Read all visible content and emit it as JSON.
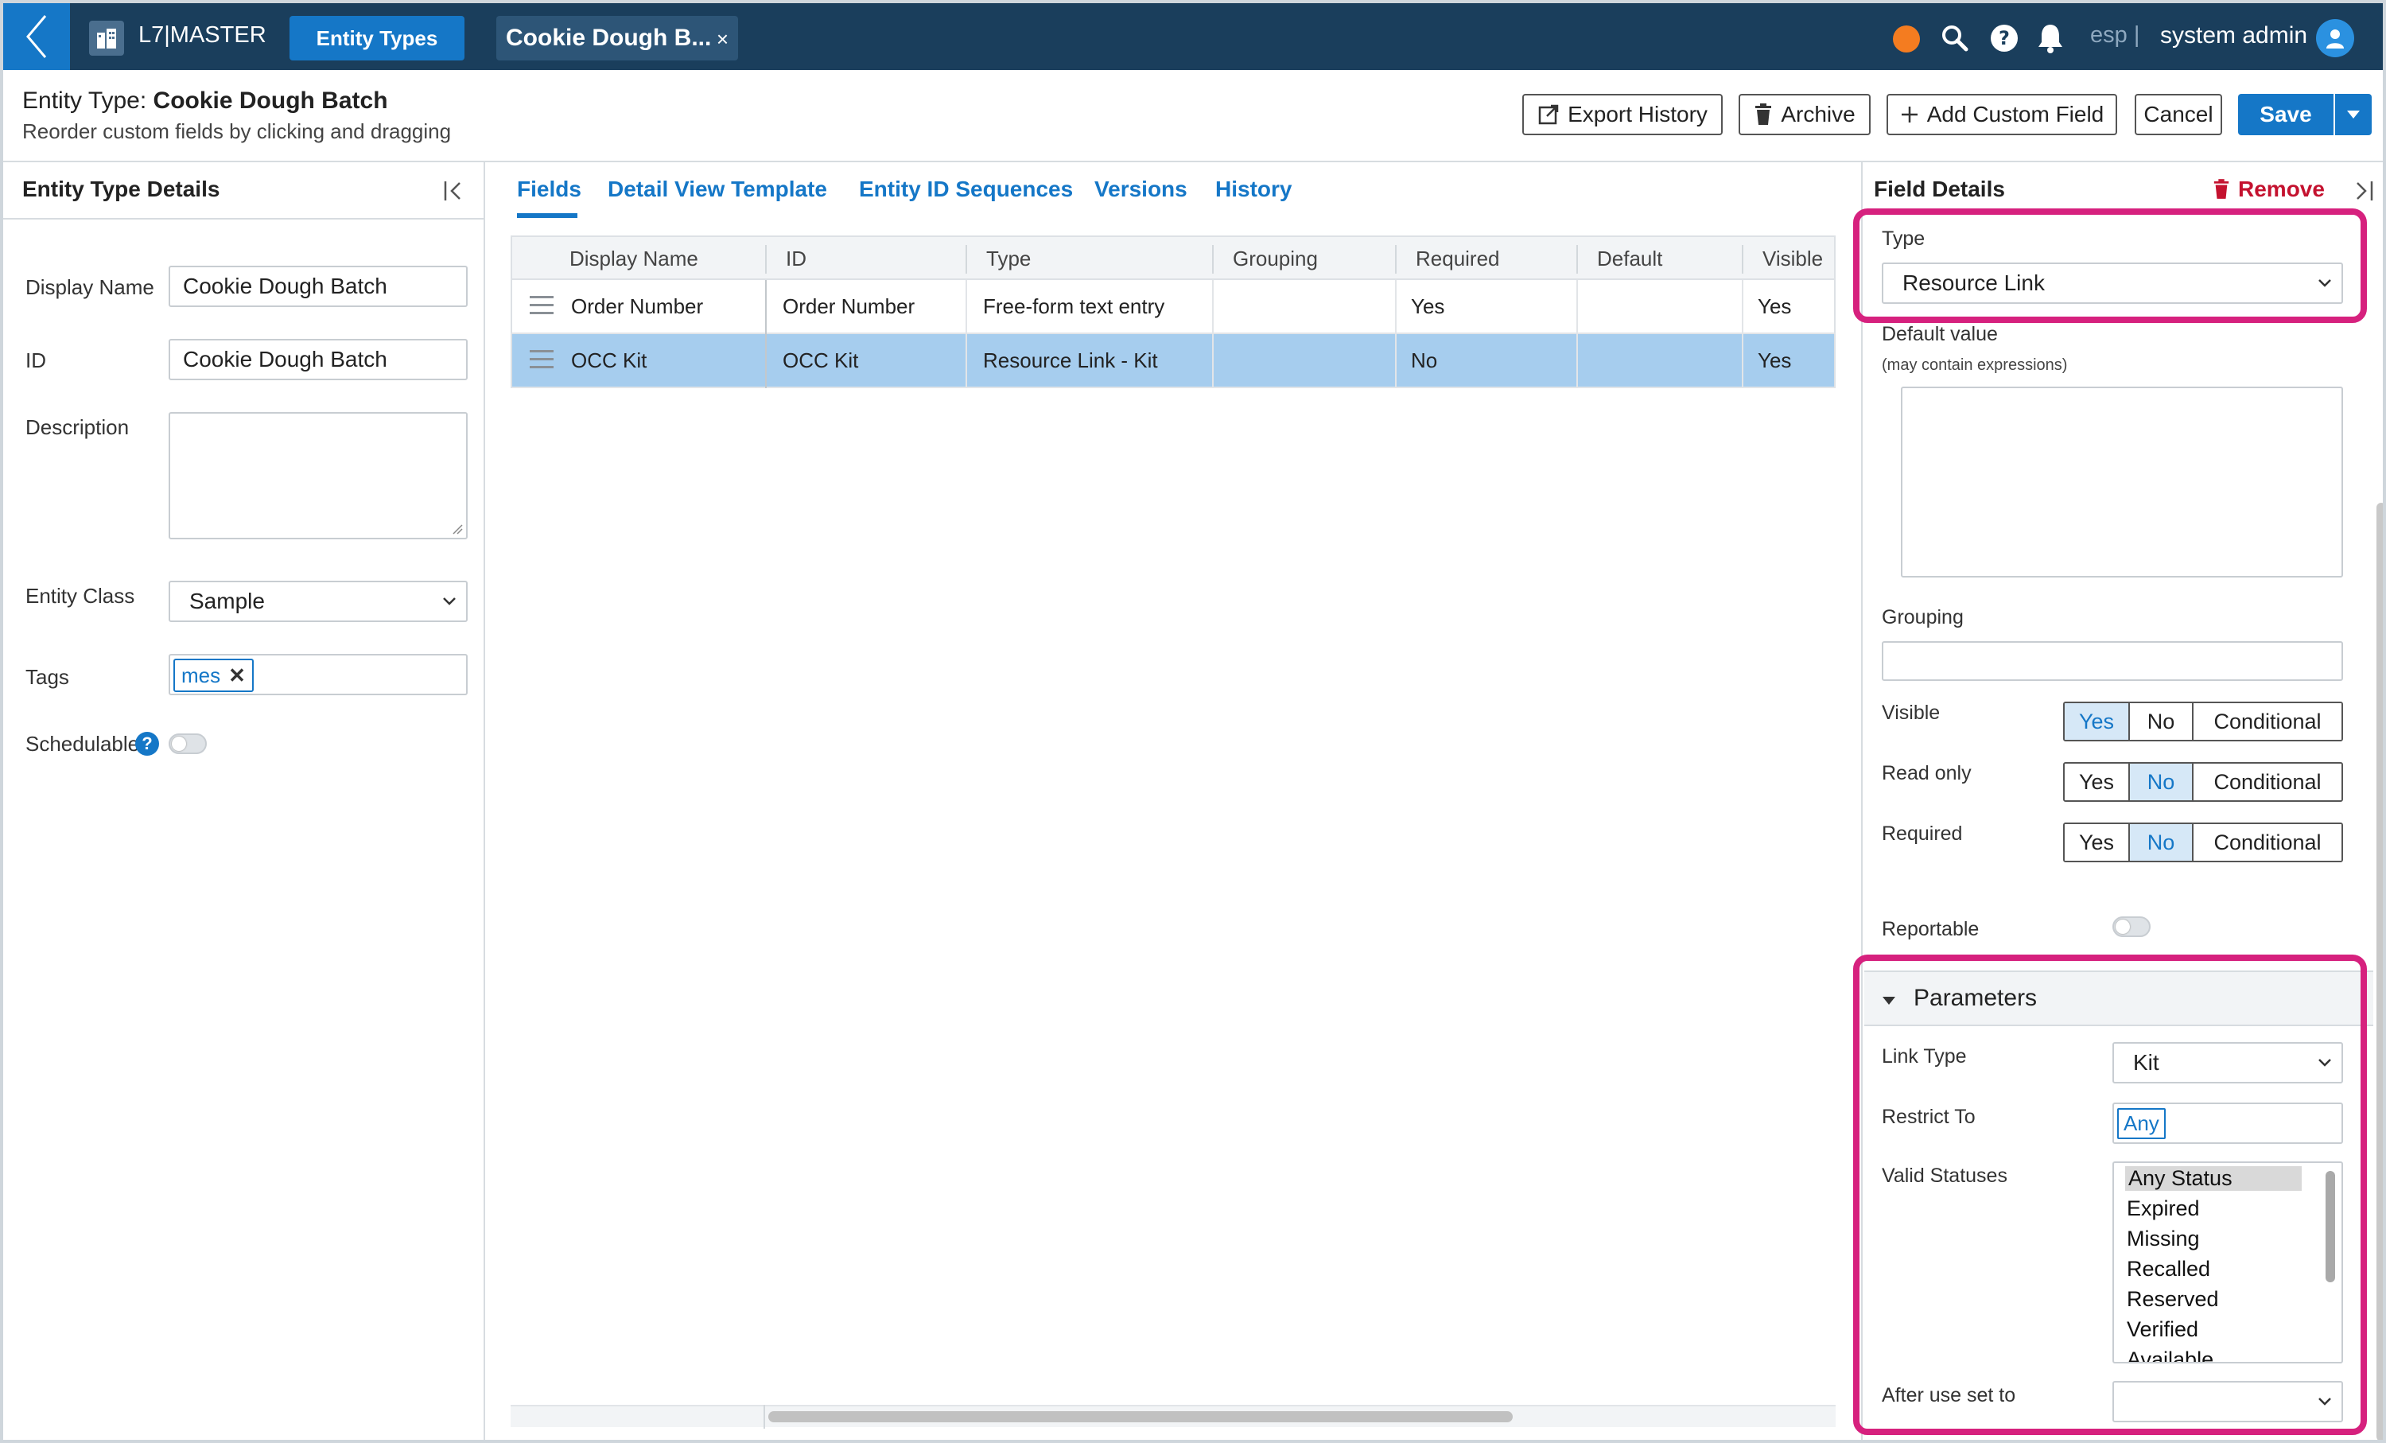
{
  "topbar": {
    "brand": "L7|MASTER",
    "entity_types_label": "Entity Types",
    "doc_tab_label": "Cookie Dough B...",
    "doc_tab_close": "×",
    "lang": "esp |",
    "user": "system admin",
    "status_color": "#f47c20"
  },
  "header": {
    "title_prefix": "Entity Type: ",
    "title_name": "Cookie Dough Batch",
    "subtitle": "Reorder custom fields by clicking and dragging",
    "export_history": "Export History",
    "archive": "Archive",
    "add_custom_field": "Add Custom Field",
    "cancel": "Cancel",
    "save": "Save"
  },
  "left_panel": {
    "title": "Entity Type Details",
    "display_name_label": "Display Name",
    "display_name_value": "Cookie Dough Batch",
    "id_label": "ID",
    "id_value": "Cookie Dough Batch",
    "description_label": "Description",
    "entity_class_label": "Entity Class",
    "entity_class_value": "Sample",
    "tags_label": "Tags",
    "tag": "mes",
    "tag_remove": "✕",
    "schedulable_label": "Schedulable",
    "help": "?"
  },
  "tabs": [
    "Fields",
    "Detail View Template",
    "Entity ID Sequences",
    "Versions",
    "History"
  ],
  "grid": {
    "columns": [
      "Display Name",
      "ID",
      "Type",
      "Grouping",
      "Required",
      "Default",
      "Visible"
    ],
    "rows": [
      {
        "display_name": "Order Number",
        "id": "Order Number",
        "type": "Free-form text entry",
        "grouping": "",
        "required": "Yes",
        "default": "",
        "visible": "Yes"
      },
      {
        "display_name": "OCC Kit",
        "id": "OCC Kit",
        "type": "Resource Link - Kit",
        "grouping": "",
        "required": "No",
        "default": "",
        "visible": "Yes"
      }
    ]
  },
  "field_details": {
    "title": "Field Details",
    "remove": "Remove",
    "type_label": "Type",
    "type_value": "Resource Link",
    "default_label": "Default value",
    "default_hint": "(may contain expressions)",
    "grouping_label": "Grouping",
    "visible_label": "Visible",
    "read_only_label": "Read only",
    "required_label": "Required",
    "opt_yes": "Yes",
    "opt_no": "No",
    "opt_conditional": "Conditional",
    "reportable_label": "Reportable",
    "params_title": "Parameters",
    "link_type_label": "Link Type",
    "link_type_value": "Kit",
    "restrict_label": "Restrict To",
    "restrict_value": "Any",
    "valid_statuses_label": "Valid Statuses",
    "statuses": [
      "Any Status",
      "Expired",
      "Missing",
      "Recalled",
      "Reserved",
      "Verified",
      "Available"
    ],
    "after_use_label": "After use set to"
  },
  "colors": {
    "topbar": "#1a3e5c",
    "accent": "#1577c7",
    "selected_row": "#a6cdee",
    "highlight": "#d6217e",
    "danger": "#c4122f"
  }
}
